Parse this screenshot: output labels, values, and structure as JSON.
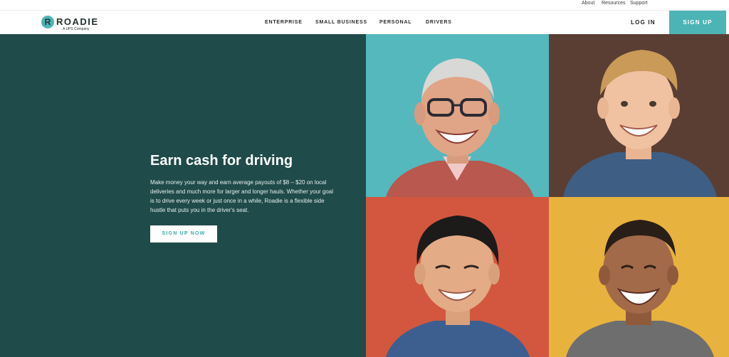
{
  "utility_nav": {
    "about": "About",
    "resources": "Resources",
    "support": "Support"
  },
  "header": {
    "logo_text": "ROADIE",
    "logo_mark": "R",
    "logo_subtitle": "A UPS Company",
    "nav": {
      "enterprise": "ENTERPRISE",
      "small_business": "SMALL BUSINESS",
      "personal": "PERSONAL",
      "drivers": "DRIVERS"
    },
    "login": "LOG IN",
    "signup": "SIGN UP"
  },
  "hero": {
    "title": "Earn cash for driving",
    "body": "Make money your way and earn average payouts of $8 – $20 on local deliveries and much more for larger and longer hauls. Whether your goal is to drive every week or just once in a while, Roadie is a flexible side hustle that puts you in the driver's seat.",
    "cta": "SIGN UP NOW"
  },
  "photos": [
    {
      "description": "older-man-photo",
      "background": "#55b8bd"
    },
    {
      "description": "young-man-photo",
      "background": "#5a3e33"
    },
    {
      "description": "man-photo",
      "background": "#d2573e"
    },
    {
      "description": "woman-photo",
      "background": "#e8b23e"
    }
  ],
  "colors": {
    "accent": "#4db4b6",
    "hero_bg": "#1f4b4a"
  }
}
